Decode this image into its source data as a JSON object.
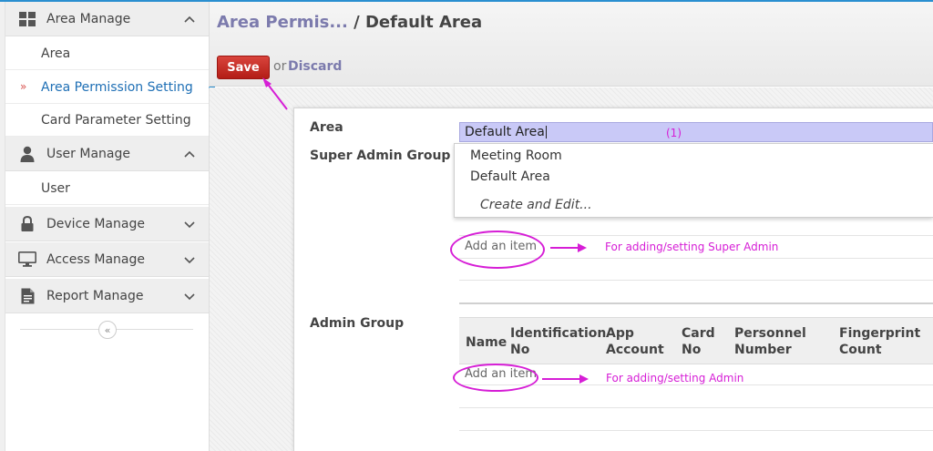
{
  "sidebar": {
    "sections": [
      {
        "label": "Area Manage",
        "icon": "grid-icon",
        "expanded": true,
        "items": [
          {
            "label": "Area"
          },
          {
            "label": "Area Permission Setting",
            "active": true
          },
          {
            "label": "Card Parameter Setting"
          }
        ]
      },
      {
        "label": "User Manage",
        "icon": "user-icon",
        "expanded": true,
        "items": [
          {
            "label": "User"
          }
        ]
      },
      {
        "label": "Device Manage",
        "icon": "lock-icon",
        "expanded": false
      },
      {
        "label": "Access Manage",
        "icon": "monitor-icon",
        "expanded": false
      },
      {
        "label": "Report Manage",
        "icon": "document-icon",
        "expanded": false
      }
    ],
    "active_marker": "»",
    "collapse_icon": "«"
  },
  "header": {
    "breadcrumb_parent": "Area Permis...",
    "breadcrumb_separator": " / ",
    "breadcrumb_current": "Default Area",
    "save_label": "Save",
    "or_text": "or",
    "discard_label": "Discard"
  },
  "form": {
    "area_label": "Area",
    "area_value": "Default Area",
    "area_annotation": "(1)",
    "super_admin_label": "Super Admin Group",
    "admin_label": "Admin Group",
    "dropdown_options": [
      "Meeting Room",
      "Default Area"
    ],
    "dropdown_create": "Create and Edit...",
    "add_item_label": "Add an item",
    "super_admin_note": "For adding/setting Super Admin",
    "admin_note": "For adding/setting Admin",
    "admin_table_headers": [
      {
        "line1": "Name",
        "line2": ""
      },
      {
        "line1": "Identification",
        "line2": "No"
      },
      {
        "line1": "App",
        "line2": "Account"
      },
      {
        "line1": "Card",
        "line2": "No"
      },
      {
        "line1": "Personnel",
        "line2": "Number"
      },
      {
        "line1": "Fingerprint",
        "line2": "Count"
      }
    ]
  },
  "colors": {
    "accent": "#2a8fd0",
    "save_button": "#c9302c",
    "link": "#7c7bad",
    "annotation": "#d61ed6",
    "input_highlight": "#c9c9f7"
  }
}
